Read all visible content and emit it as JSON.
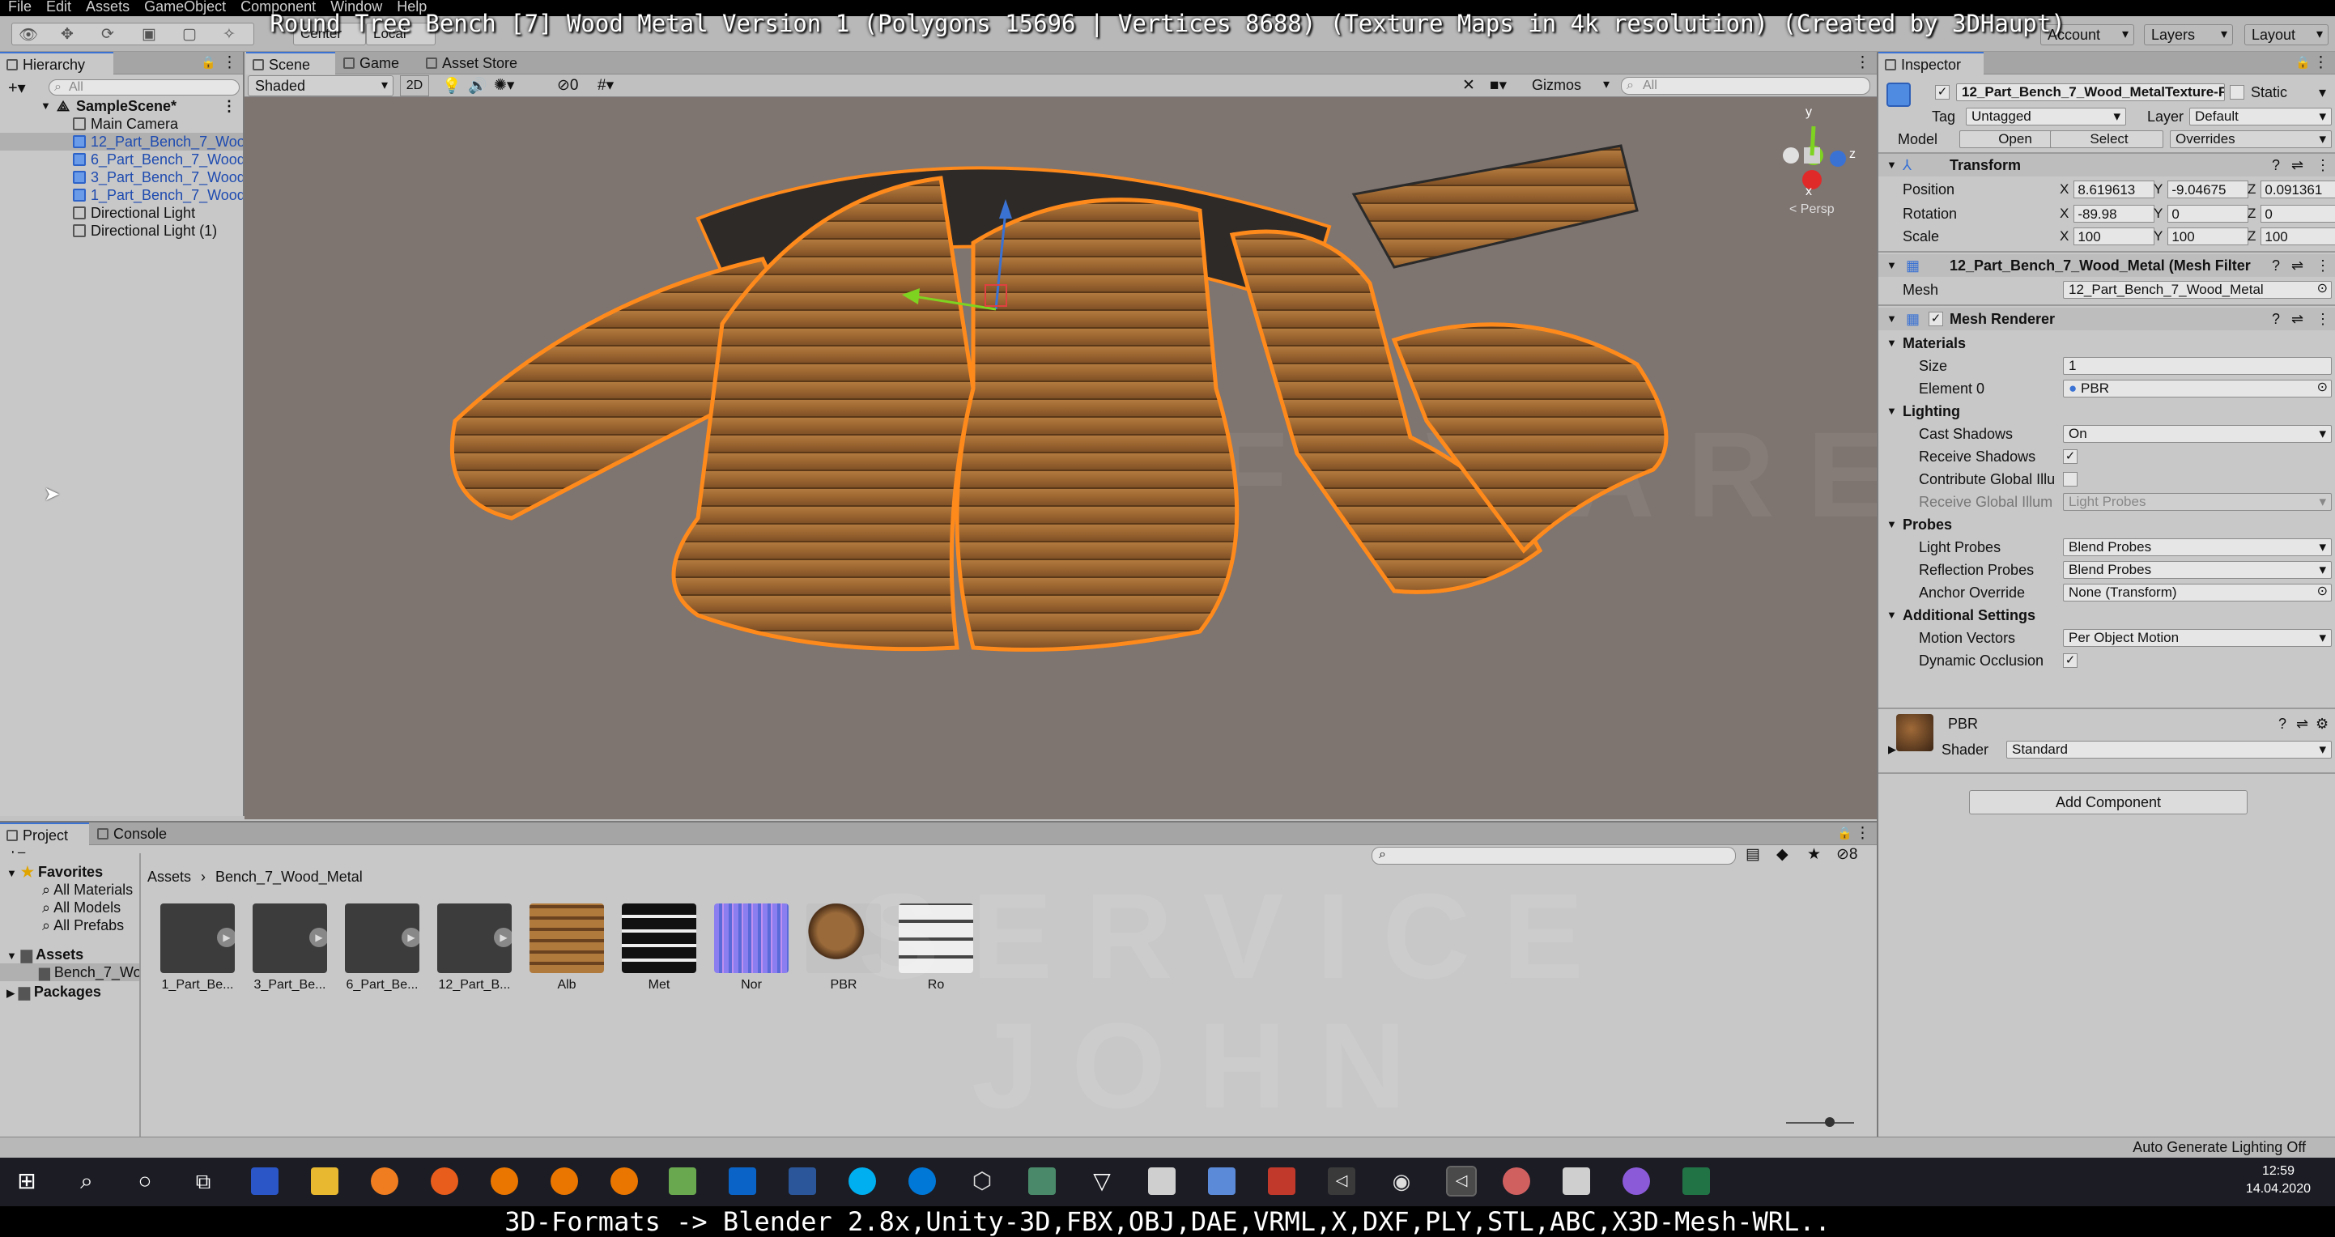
{
  "menubar": [
    "File",
    "Edit",
    "Assets",
    "GameObject",
    "Component",
    "Window",
    "Help"
  ],
  "overlay_title": "Round Tree Bench [7] Wood Metal Version 1 (Polygons 15696 | Vertices 8688) (Texture Maps in 4k resolution) (Created by 3DHaupt)",
  "toolbar": {
    "center_label": "Center",
    "local_label": "Local",
    "account": "Account",
    "layers": "Layers",
    "layout": "Layout"
  },
  "hierarchy": {
    "tab": "Hierarchy",
    "search_placeholder": "All",
    "scene_name": "SampleScene*",
    "items": [
      "Main Camera",
      "12_Part_Bench_7_Woo",
      "6_Part_Bench_7_Wood",
      "3_Part_Bench_7_Wood",
      "1_Part_Bench_7_Wood",
      "Directional Light",
      "Directional Light (1)"
    ]
  },
  "scene": {
    "tabs": [
      "Scene",
      "Game",
      "Asset Store"
    ],
    "shading": "Shaded",
    "mode_2d": "2D",
    "hidden_count": "0",
    "gizmos": "Gizmos",
    "search_placeholder": "All",
    "persp": "< Persp",
    "gizmo_axes": {
      "y": "y",
      "x": "x",
      "z": "z"
    }
  },
  "inspector": {
    "tab": "Inspector",
    "object_name": "12_Part_Bench_7_Wood_MetalTexture-F",
    "static_label": "Static",
    "tag_label": "Tag",
    "tag_value": "Untagged",
    "layer_label": "Layer",
    "layer_value": "Default",
    "model_label": "Model",
    "open_btn": "Open",
    "select_btn": "Select",
    "overrides": "Overrides",
    "transform": {
      "title": "Transform",
      "position": {
        "label": "Position",
        "x": "8.619613",
        "y": "-9.04675",
        "z": "0.091361"
      },
      "rotation": {
        "label": "Rotation",
        "x": "-89.98",
        "y": "0",
        "z": "0"
      },
      "scale": {
        "label": "Scale",
        "x": "100",
        "y": "100",
        "z": "100"
      }
    },
    "mesh_filter": {
      "title": "12_Part_Bench_7_Wood_Metal (Mesh Filter",
      "mesh_label": "Mesh",
      "mesh_value": "12_Part_Bench_7_Wood_Metal"
    },
    "mesh_renderer": {
      "title": "Mesh Renderer",
      "materials": "Materials",
      "size_label": "Size",
      "size_value": "1",
      "element0_label": "Element 0",
      "element0_value": "PBR",
      "lighting": "Lighting",
      "cast_shadows_label": "Cast Shadows",
      "cast_shadows_value": "On",
      "receive_shadows_label": "Receive Shadows",
      "contribute_gi_label": "Contribute Global Illu",
      "receive_gi_label": "Receive Global Illum",
      "receive_gi_value": "Light Probes",
      "probes": "Probes",
      "light_probes_label": "Light Probes",
      "light_probes_value": "Blend Probes",
      "reflection_probes_label": "Reflection Probes",
      "reflection_probes_value": "Blend Probes",
      "anchor_override_label": "Anchor Override",
      "anchor_override_value": "None (Transform)",
      "additional": "Additional Settings",
      "motion_vectors_label": "Motion Vectors",
      "motion_vectors_value": "Per Object Motion",
      "dynamic_occlusion_label": "Dynamic Occlusion"
    },
    "material": {
      "name": "PBR",
      "shader_label": "Shader",
      "shader_value": "Standard"
    },
    "add_component": "Add Component"
  },
  "project": {
    "tabs": [
      "Project",
      "Console"
    ],
    "hidden_count": "8",
    "favorites": "Favorites",
    "fav_items": [
      "All Materials",
      "All Models",
      "All Prefabs"
    ],
    "assets": "Assets",
    "assets_child": "Bench_7_Wo",
    "packages": "Packages",
    "breadcrumb": [
      "Assets",
      "Bench_7_Wood_Metal"
    ],
    "items": [
      "1_Part_Be...",
      "3_Part_Be...",
      "6_Part_Be...",
      "12_Part_B...",
      "Alb",
      "Met",
      "Nor",
      "PBR",
      "Ro"
    ]
  },
  "statusbar": {
    "right": "Auto Generate Lighting Off"
  },
  "taskbar": {
    "time": "12:59",
    "date": "14.04.2020"
  },
  "caption": "3D-Formats -> Blender 2.8x,Unity-3D,FBX,OBJ,DAE,VRML,X,DXF,PLY,STL,ABC,X3D-Mesh-WRL..",
  "watermark": [
    "SOFTWARE",
    "SERVICE",
    "JOHN"
  ],
  "colors": {
    "accent": "#3a72d4",
    "selection_outline": "#ff8a1c",
    "wood": "#a8743c"
  }
}
